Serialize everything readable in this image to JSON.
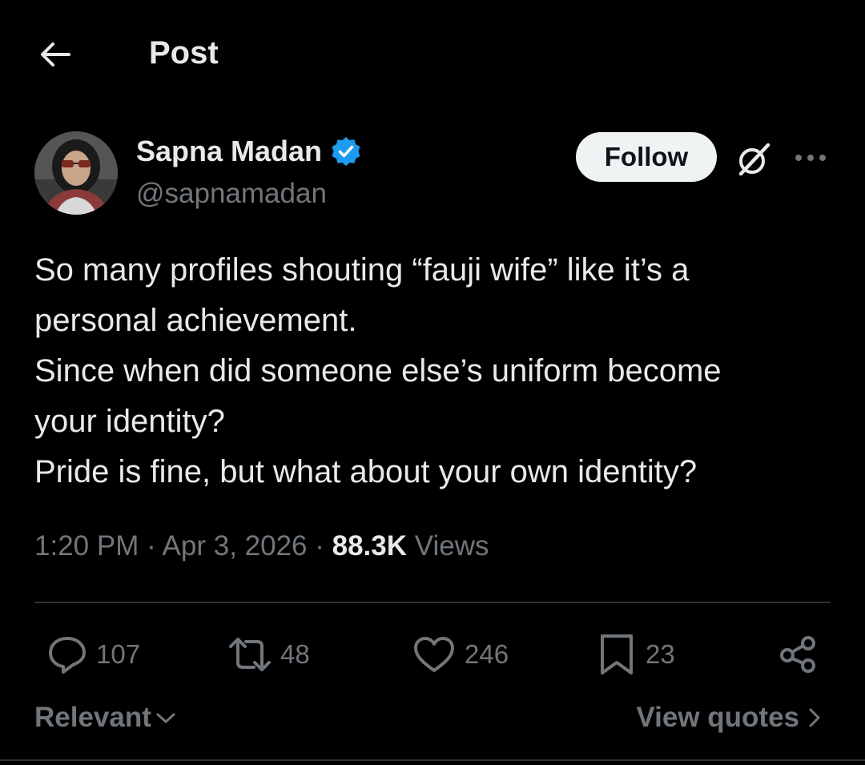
{
  "header": {
    "title": "Post",
    "back_icon": "arrow-left-icon"
  },
  "author": {
    "name": "Sapna Madan",
    "handle": "@sapnamadan",
    "verified": true,
    "verified_color": "#1d9bf0"
  },
  "actions_top": {
    "follow_label": "Follow",
    "grok_icon": "grok-icon",
    "more_icon": "more-dots-icon"
  },
  "post": {
    "lines": [
      "So many profiles shouting “fauji wife” like it’s a",
      "personal achievement.",
      "Since when did someone else’s uniform become",
      "your identity?",
      "Pride is fine, but what about your own identity?"
    ],
    "time": "1:20 PM",
    "sep1": " · ",
    "date": "Apr 3, 2026",
    "sep2": " · ",
    "views_count": "88.3K",
    "views_label": " Views"
  },
  "stats": {
    "replies": "107",
    "reposts": "48",
    "likes": "246",
    "bookmarks": "23"
  },
  "footer": {
    "sort_label": "Relevant",
    "view_quotes_label": "View quotes"
  },
  "colors": {
    "background": "#000000",
    "text": "#e7e9ea",
    "muted": "#71767b",
    "divider": "#2f3336",
    "accent": "#1d9bf0"
  }
}
